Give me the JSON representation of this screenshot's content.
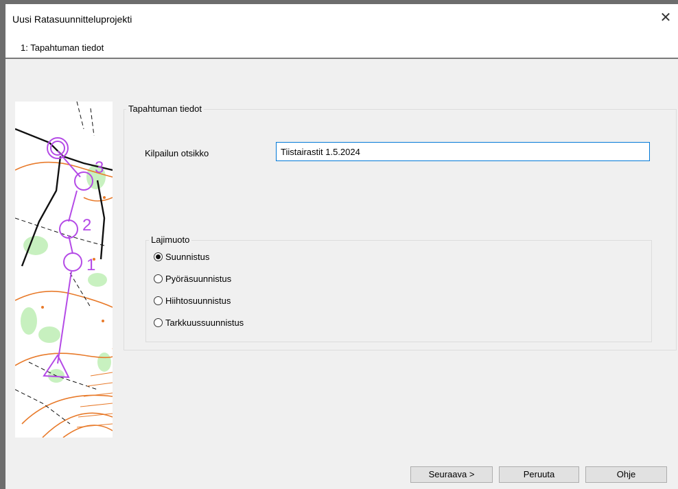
{
  "window": {
    "title": "Uusi Ratasuunnitteluprojekti",
    "close_glyph": "✕"
  },
  "wizard": {
    "step_label": "1: Tapahtuman tiedot"
  },
  "event_group": {
    "legend": "Tapahtuman tiedot",
    "title_label": "Kilpailun otsikko",
    "title_value": "Tiistairastit 1.5.2024"
  },
  "sport_group": {
    "legend": "Lajimuoto",
    "options": [
      {
        "label": "Suunnistus",
        "checked": true
      },
      {
        "label": "Pyöräsuunnistus",
        "checked": false
      },
      {
        "label": "Hiihtosuunnistus",
        "checked": false
      },
      {
        "label": "Tarkkuussuunnistus",
        "checked": false
      }
    ]
  },
  "course_map": {
    "control_numbers": [
      "3",
      "2",
      "1"
    ]
  },
  "buttons": {
    "next": "Seuraava >",
    "cancel": "Peruuta",
    "help": "Ohje"
  },
  "colors": {
    "course": "#b44ae6",
    "input_border": "#0078d7",
    "vegetation": "#62d64a",
    "contour": "#e87a2a"
  }
}
